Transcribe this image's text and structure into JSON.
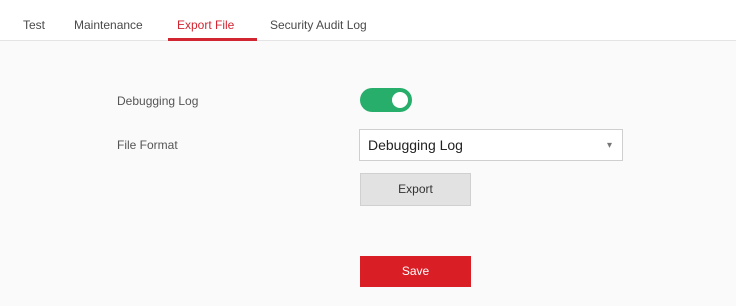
{
  "tabs": {
    "test": "Test",
    "maintenance": "Maintenance",
    "export_file": "Export File",
    "security_audit_log": "Security Audit Log",
    "active": "Export File"
  },
  "form": {
    "debugging_log_label": "Debugging Log",
    "debugging_log_enabled": true,
    "file_format_label": "File Format",
    "file_format_value": "Debugging Log",
    "export_label": "Export",
    "save_label": "Save"
  },
  "colors": {
    "accent": "#d12631",
    "toggle_on": "#26ae6a",
    "save_button": "#d91e25"
  },
  "icons": {
    "select_caret": "chevron-down-icon"
  }
}
